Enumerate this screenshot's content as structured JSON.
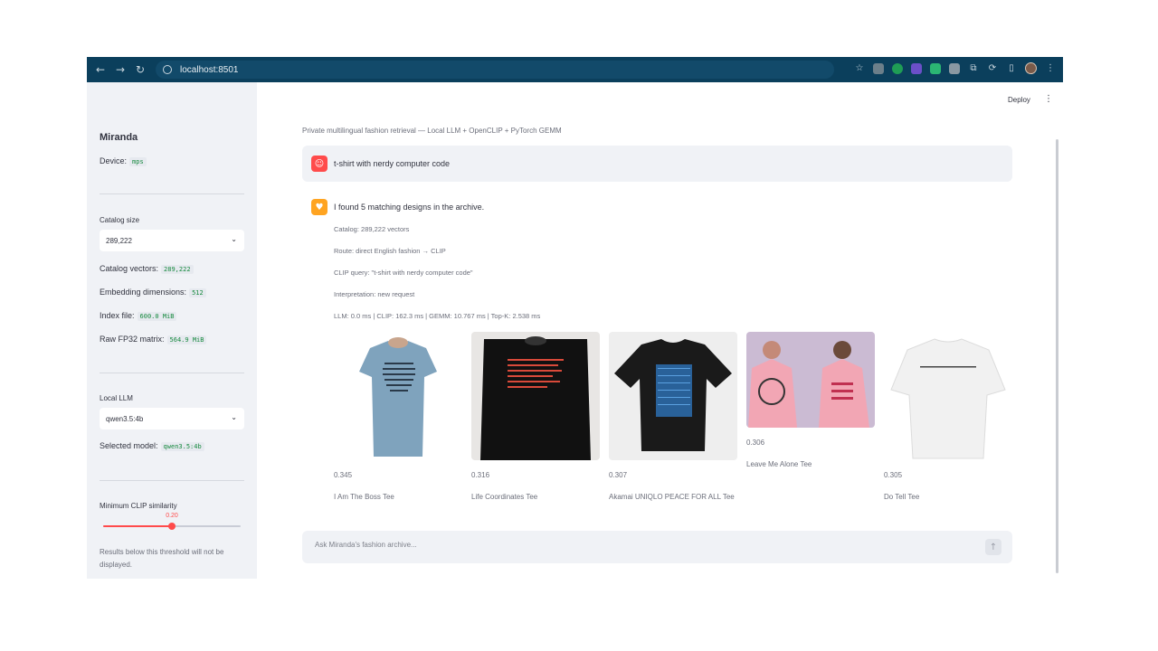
{
  "browser": {
    "url": "localhost:8501",
    "back_icon": "arrow-left-icon",
    "forward_icon": "arrow-right-icon",
    "reload_icon": "reload-icon"
  },
  "app": {
    "deploy_label": "Deploy",
    "caption": "Private multilingual fashion retrieval — Local LLM + OpenCLIP + PyTorch GEMM"
  },
  "sidebar": {
    "title": "Miranda",
    "device_label": "Device:",
    "device_value": "mps",
    "catalog_size_label": "Catalog size",
    "catalog_size_selected": "289,222",
    "stats": [
      {
        "label": "Catalog vectors:",
        "value": "289,222"
      },
      {
        "label": "Embedding dimensions:",
        "value": "512"
      },
      {
        "label": "Index file:",
        "value": "600.0 MiB"
      },
      {
        "label": "Raw FP32 matrix:",
        "value": "564.9 MiB"
      }
    ],
    "local_llm_label": "Local LLM",
    "local_llm_selected": "qwen3.5:4b",
    "selected_model_label": "Selected model:",
    "selected_model_value": "qwen3.5:4b",
    "similarity_label": "Minimum CLIP similarity",
    "similarity_value": "0.20",
    "similarity_fraction": 0.5,
    "threshold_note": "Results below this threshold will not be displayed."
  },
  "chat": {
    "user_message": "t-shirt with nerdy computer code",
    "assistant_message": "I found 5 matching designs in the archive.",
    "meta": [
      "Catalog: 289,222 vectors",
      "Route: direct English fashion → CLIP",
      "CLIP query: \"t-shirt with nerdy computer code\"",
      "Interpretation: new request",
      "LLM: 0.0 ms | CLIP: 162.3 ms | GEMM: 10.767 ms | Top-K: 2.538 ms"
    ],
    "results": [
      {
        "score": "0.345",
        "name": "I Am The Boss Tee",
        "shirt_color": "#7fa3bd",
        "bg": "#ffffff"
      },
      {
        "score": "0.316",
        "name": "Life Coordinates Tee",
        "shirt_color": "#111111",
        "bg": "#e8e6e4"
      },
      {
        "score": "0.307",
        "name": "Akamai UNIQLO PEACE FOR ALL Tee",
        "shirt_color": "#1a1a1a",
        "bg": "#eeeeee"
      },
      {
        "score": "0.306",
        "name": "Leave Me Alone Tee",
        "shirt_color": "#f2a6b4",
        "bg": "#cbbbd3"
      },
      {
        "score": "0.305",
        "name": "Do Tell Tee",
        "shirt_color": "#f4f4f4",
        "bg": "#ffffff"
      }
    ],
    "input_placeholder": "Ask Miranda's fashion archive..."
  },
  "colors": {
    "chrome": "#0b3f5c",
    "sidebar": "#f0f2f6",
    "accent": "#ff4b4b",
    "user_avatar": "#ff4b4b",
    "assistant_avatar": "#ffa421",
    "code_text": "#168a3e"
  }
}
